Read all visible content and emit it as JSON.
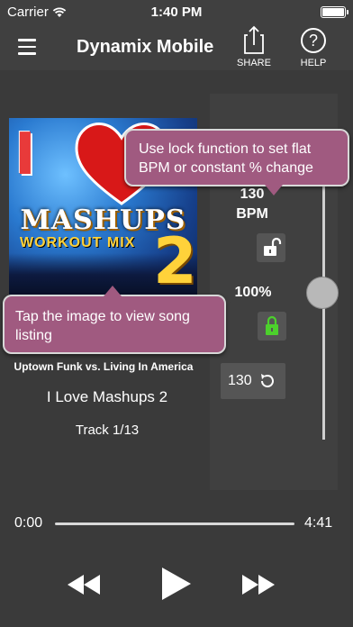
{
  "status_bar": {
    "carrier": "Carrier",
    "time": "1:40 PM"
  },
  "nav": {
    "title": "Dynamix Mobile",
    "share_label": "SHARE",
    "help_label": "HELP",
    "help_glyph": "?"
  },
  "album_art": {
    "line1": "I",
    "line2": "MASHUPS",
    "line3": "WORKOUT MIX",
    "line4": "2"
  },
  "tempo": {
    "bpm_value": "130",
    "bpm_unit": "BPM",
    "percent": "100%",
    "reset_value": "130"
  },
  "tooltips": {
    "lock": "Use lock function to set flat BPM or constant % change",
    "image": "Tap the image to view song listing"
  },
  "song": {
    "title": "Uptown Funk  vs. Living In America",
    "album": "I Love Mashups 2",
    "track": "Track 1/13"
  },
  "progress": {
    "elapsed": "0:00",
    "total": "4:41",
    "fraction": 0.0
  },
  "colors": {
    "background": "#3a3a3a",
    "panel": "#404040",
    "tooltip": "#a05a80",
    "lock_active": "#4cd02c"
  }
}
